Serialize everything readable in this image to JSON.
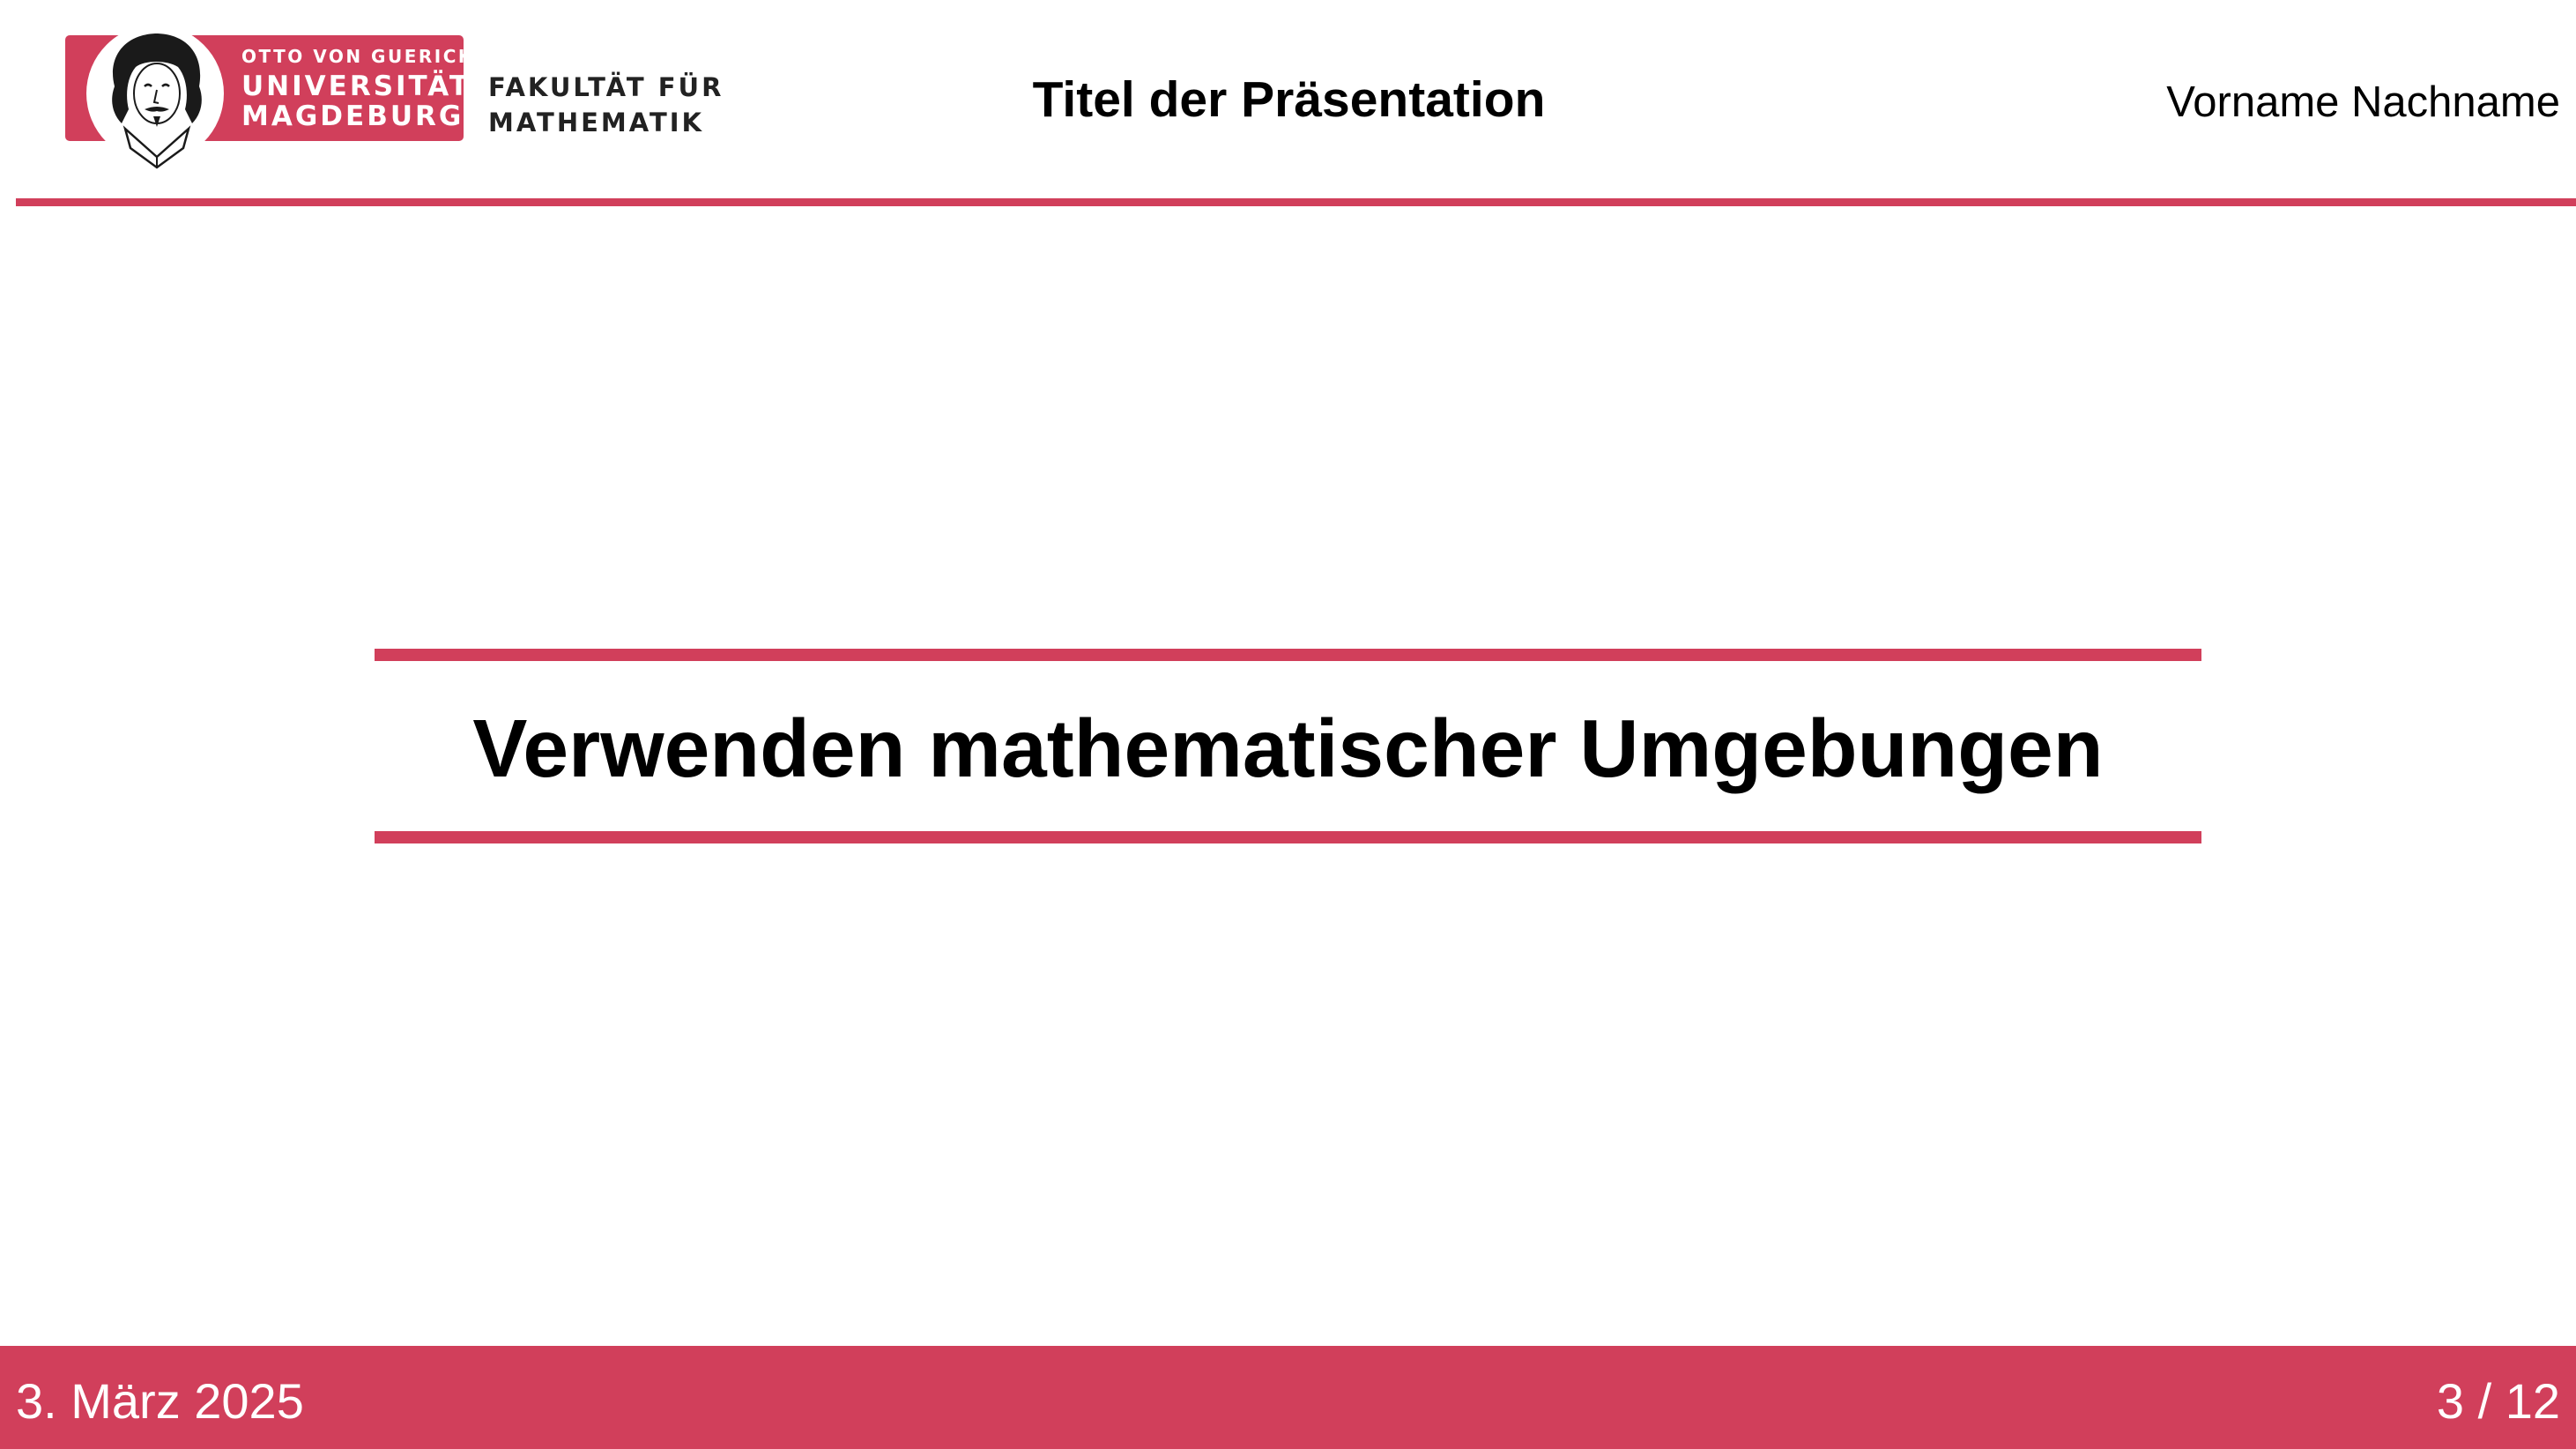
{
  "header": {
    "logo": {
      "line_1": "OTTO VON GUERICKE",
      "line_2": "UNIVERSITÄT",
      "line_3": "MAGDEBURG",
      "faculty_line_1": "FAKULTÄT FÜR",
      "faculty_line_2": "MATHEMATIK",
      "portrait_icon": "guericke-portrait-icon"
    },
    "title": "Titel der Präsentation",
    "author": "Vorname Nachname"
  },
  "main": {
    "section_title": "Verwenden mathematischer Umgebungen"
  },
  "footer": {
    "date": "3. März 2025",
    "page": "3 / 12"
  },
  "colors": {
    "accent": "#d13f5b",
    "text": "#000000",
    "background": "#ffffff"
  }
}
